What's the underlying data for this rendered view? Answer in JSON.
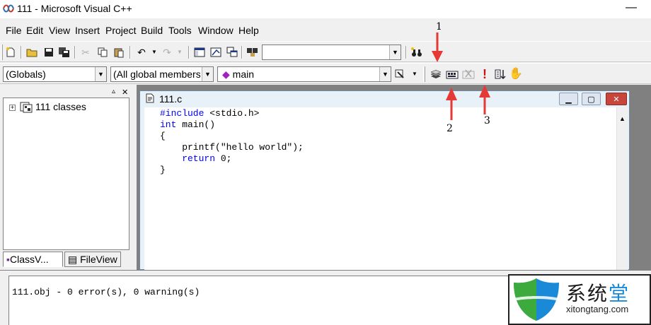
{
  "window": {
    "title": "111 - Microsoft Visual C++",
    "minimize_glyph": "—"
  },
  "menu": {
    "items": [
      "File",
      "Edit",
      "View",
      "Insert",
      "Project",
      "Build",
      "Tools",
      "Window",
      "Help"
    ]
  },
  "toolbar1": {
    "find_combo_value": ""
  },
  "toolbar2": {
    "globals_combo": "(Globals)",
    "members_combo": "(All global members",
    "function_combo": "main"
  },
  "workspace": {
    "tree_root": "111 classes",
    "tabs": [
      "ClassV...",
      "FileView"
    ]
  },
  "editor": {
    "file_title": "111.c",
    "code_lines": [
      {
        "kw": "#include",
        "rest": " <stdio.h>"
      },
      {
        "kw": "int",
        "rest": " main()"
      },
      {
        "kw": "",
        "rest": "{"
      },
      {
        "kw": "",
        "rest": "    printf(\"hello world\");"
      },
      {
        "kw": "    return",
        "rest": " 0;"
      },
      {
        "kw": "",
        "rest": "}"
      }
    ]
  },
  "output": {
    "message": "111.obj - 0 error(s), 0 warning(s)"
  },
  "annotations": [
    "1",
    "2",
    "3"
  ],
  "logo": {
    "chars": [
      "系",
      "统",
      "堂"
    ],
    "url": "xitongtang.com"
  },
  "colors": {
    "keyword": "#0000ff",
    "annotation_arrow": "#e53935",
    "logo_blue": "#1a8ad8",
    "logo_green": "#3caa3c"
  }
}
